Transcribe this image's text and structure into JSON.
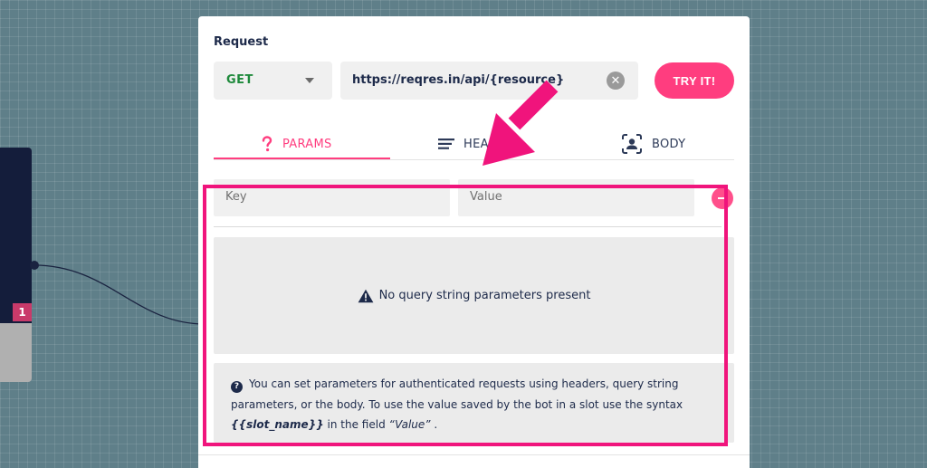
{
  "canvas": {
    "node_badge": "1"
  },
  "request": {
    "title": "Request",
    "method": "GET",
    "url": "https://reqres.in/api/{resource}",
    "try_label": "TRY IT!"
  },
  "tabs": [
    {
      "label": "PARAMS",
      "icon": "question-icon",
      "active": true
    },
    {
      "label": "HEADERS",
      "icon": "lines-icon",
      "active": false
    },
    {
      "label": "BODY",
      "icon": "user-scan-icon",
      "active": false
    }
  ],
  "params": {
    "key_placeholder": "Key",
    "value_placeholder": "Value",
    "empty_message": "No query string parameters present",
    "info_prefix": "You can set parameters for authenticated requests using headers, query string parameters, or the body. To use the value saved by the bot in a slot use the syntax",
    "info_code": "{{slot_name}}",
    "info_middle": "in the field",
    "info_field": "“Value”",
    "info_suffix": "."
  },
  "colors": {
    "accent": "#ff3d7f",
    "annotation": "#f0147c",
    "method_green": "#1f8a3c",
    "navy": "#1d2a4a"
  }
}
